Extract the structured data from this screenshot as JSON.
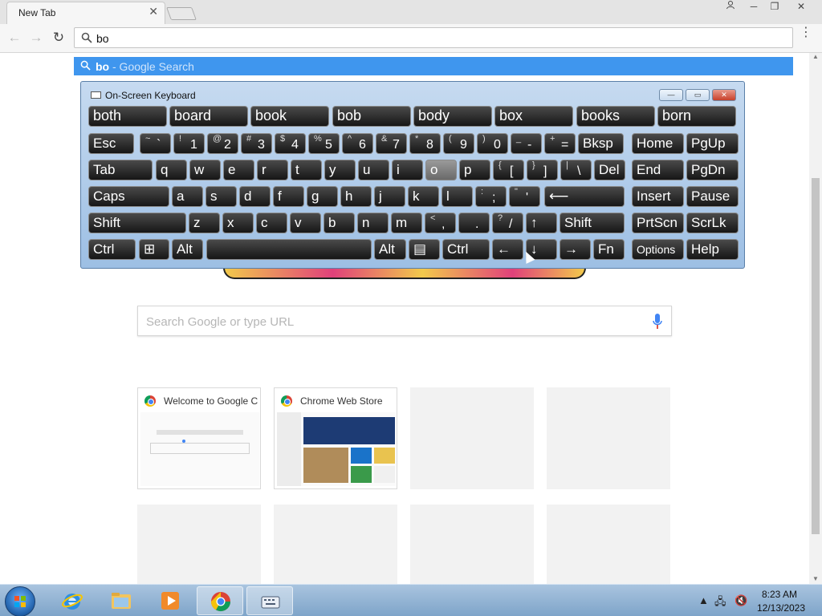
{
  "browser": {
    "tab_title": "New Tab",
    "tab_close": "✕",
    "window_controls": [
      "─",
      "❐",
      "✕"
    ],
    "user_icon": "person-icon",
    "back": "←",
    "forward": "→",
    "reload": "↻",
    "omnibox_value": "bo",
    "menu": "⋮"
  },
  "suggestion": {
    "query": "bo",
    "suffix": " - Google Search"
  },
  "ntp": {
    "search_placeholder": "Search Google or type URL",
    "tiles": [
      {
        "title": "Welcome to Google C"
      },
      {
        "title": "Chrome Web Store"
      },
      {
        "title": ""
      },
      {
        "title": ""
      },
      {
        "title": ""
      },
      {
        "title": ""
      },
      {
        "title": ""
      },
      {
        "title": ""
      }
    ]
  },
  "osk": {
    "title": "On-Screen Keyboard",
    "window_controls": [
      "—",
      "▭",
      "✕"
    ],
    "predictions": [
      "both",
      "board",
      "book",
      "bob",
      "body",
      "box",
      "books",
      "born"
    ],
    "row1": [
      {
        "main": "Esc"
      },
      {
        "sub": "~",
        "main": "`"
      },
      {
        "sub": "!",
        "main": "1"
      },
      {
        "sub": "@",
        "main": "2"
      },
      {
        "sub": "#",
        "main": "3"
      },
      {
        "sub": "$",
        "main": "4"
      },
      {
        "sub": "%",
        "main": "5"
      },
      {
        "sub": "^",
        "main": "6"
      },
      {
        "sub": "&",
        "main": "7"
      },
      {
        "sub": "*",
        "main": "8"
      },
      {
        "sub": "(",
        "main": "9"
      },
      {
        "sub": ")",
        "main": "0"
      },
      {
        "sub": "_",
        "main": "-"
      },
      {
        "sub": "+",
        "main": "="
      },
      {
        "main": "Bksp"
      },
      {
        "main": "Home"
      },
      {
        "main": "PgUp"
      }
    ],
    "row2": [
      "Tab",
      "q",
      "w",
      "e",
      "r",
      "t",
      "y",
      "u",
      "i",
      "o",
      "p",
      "[",
      "]",
      "\\",
      "Del",
      "End",
      "PgDn"
    ],
    "row2_sub": {
      "[": "{",
      "]": "}",
      "\\": "|"
    },
    "row3": [
      "Caps",
      "a",
      "s",
      "d",
      "f",
      "g",
      "h",
      "j",
      "k",
      "l",
      ";",
      "'",
      "⟵",
      "Insert",
      "Pause"
    ],
    "row3_sub": {
      ";": ":",
      "'": "\""
    },
    "row4": [
      "Shift",
      "z",
      "x",
      "c",
      "v",
      "b",
      "n",
      "m",
      ",",
      ".",
      "/",
      "↑",
      "Shift",
      "PrtScn",
      "ScrLk"
    ],
    "row4_sub": {
      ",": "<",
      ".": ">",
      "/": "?"
    },
    "row5": [
      "Ctrl",
      "⊞",
      "Alt",
      "",
      "Alt",
      "▤",
      "Ctrl",
      "←",
      "↓",
      "→",
      "Fn",
      "Options",
      "Help"
    ]
  },
  "taskbar": {
    "time": "8:23 AM",
    "date": "12/13/2023",
    "apps": [
      "internet-explorer-icon",
      "file-explorer-icon",
      "media-player-icon",
      "chrome-icon",
      "on-screen-keyboard-icon"
    ]
  },
  "colors": {
    "suggestion_bg": "#3f96ee",
    "osk_bg": "#b3cde9",
    "key_bg": "#2a2a2a",
    "taskbar_bg": "#94b6d8"
  }
}
